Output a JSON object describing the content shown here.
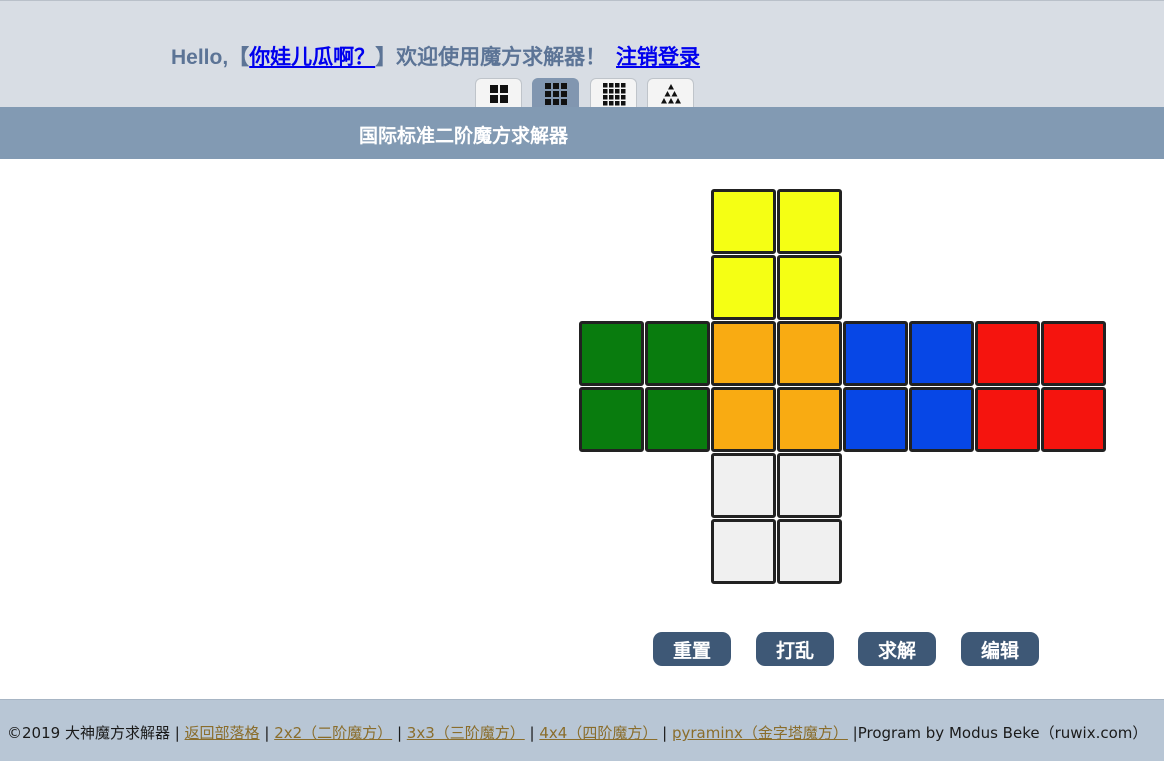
{
  "header": {
    "hello_prefix": "Hello,【",
    "username": "你娃儿瓜啊？",
    "welcome_suffix": "】欢迎使用魔方求解器！",
    "logout_label": "注销登录"
  },
  "tabs": [
    {
      "name": "2x2",
      "icon": "grid-2x2-icon",
      "active": false
    },
    {
      "name": "3x3",
      "icon": "grid-3x3-icon",
      "active": true
    },
    {
      "name": "4x4",
      "icon": "grid-4x4-icon",
      "active": false
    },
    {
      "name": "pyraminx",
      "icon": "pyramid-icon",
      "active": false
    }
  ],
  "page": {
    "title": "国际标准二阶魔方求解器"
  },
  "cube": {
    "colors": {
      "U": "#f5ff14",
      "L": "#097c0e",
      "F": "#f9ab12",
      "R": "#0747e6",
      "B": "#f5140e",
      "D": "#f0f0f0"
    },
    "faces": {
      "U": [
        "U",
        "U",
        "U",
        "U"
      ],
      "L": [
        "L",
        "L",
        "L",
        "L"
      ],
      "F": [
        "F",
        "F",
        "F",
        "F"
      ],
      "R": [
        "R",
        "R",
        "R",
        "R"
      ],
      "B": [
        "B",
        "B",
        "B",
        "B"
      ],
      "D": [
        "D",
        "D",
        "D",
        "D"
      ]
    }
  },
  "actions": {
    "reset_label": "重置",
    "scramble_label": "打乱",
    "solve_label": "求解",
    "edit_label": "编辑"
  },
  "footer": {
    "copyright": "©2019 大神魔方求解器 |",
    "links": [
      "返回部落格",
      "2x2（二阶魔方）",
      "3x3（三阶魔方）",
      "4x4（四阶魔方）",
      "pyraminx（金字塔魔方）"
    ],
    "separator": "|",
    "credit": "|Program by Modus Beke（ruwix.com）"
  },
  "theme": {
    "header_bg": "#d8dde4",
    "title_bar_bg": "#829ab3",
    "button_bg": "#3e5876",
    "footer_bg": "#b8c6d5",
    "link_color": "#0000ee",
    "footer_link_color": "#8a6d2b"
  }
}
